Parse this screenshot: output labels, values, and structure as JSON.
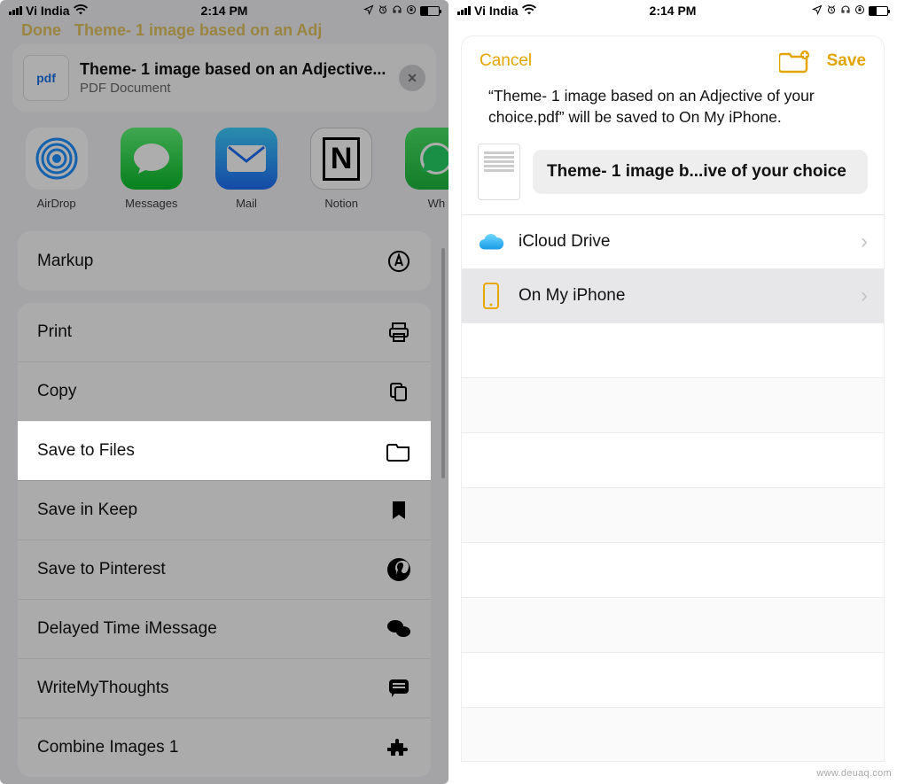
{
  "status": {
    "carrier": "Vi India",
    "time": "2:14 PM"
  },
  "share": {
    "title": "Theme- 1 image based on an Adjective...",
    "subtitle": "PDF Document",
    "pdf_badge": "pdf",
    "apps": [
      {
        "label": "AirDrop"
      },
      {
        "label": "Messages"
      },
      {
        "label": "Mail"
      },
      {
        "label": "Notion"
      },
      {
        "label": "Wh"
      }
    ],
    "actions_top": [
      {
        "label": "Markup",
        "icon": "markup"
      }
    ],
    "actions": [
      {
        "label": "Print",
        "icon": "print"
      },
      {
        "label": "Copy",
        "icon": "copy"
      },
      {
        "label": "Save to Files",
        "icon": "folder",
        "highlight": true
      },
      {
        "label": "Save in Keep",
        "icon": "bookmark"
      },
      {
        "label": "Save to Pinterest",
        "icon": "pinterest"
      },
      {
        "label": "Delayed Time iMessage",
        "icon": "chat"
      },
      {
        "label": "WriteMyThoughts",
        "icon": "note"
      },
      {
        "label": "Combine Images 1",
        "icon": "puzzle"
      }
    ]
  },
  "files": {
    "cancel": "Cancel",
    "save": "Save",
    "message": "“Theme- 1 image based on an Adjective of your choice.pdf” will be saved to On My iPhone.",
    "filename": "Theme- 1 image b...ive of your choice",
    "locations": [
      {
        "label": "iCloud Drive",
        "icon": "cloud",
        "selected": false
      },
      {
        "label": "On My iPhone",
        "icon": "phone",
        "selected": true
      }
    ]
  },
  "watermark": "www.deuaq.com"
}
